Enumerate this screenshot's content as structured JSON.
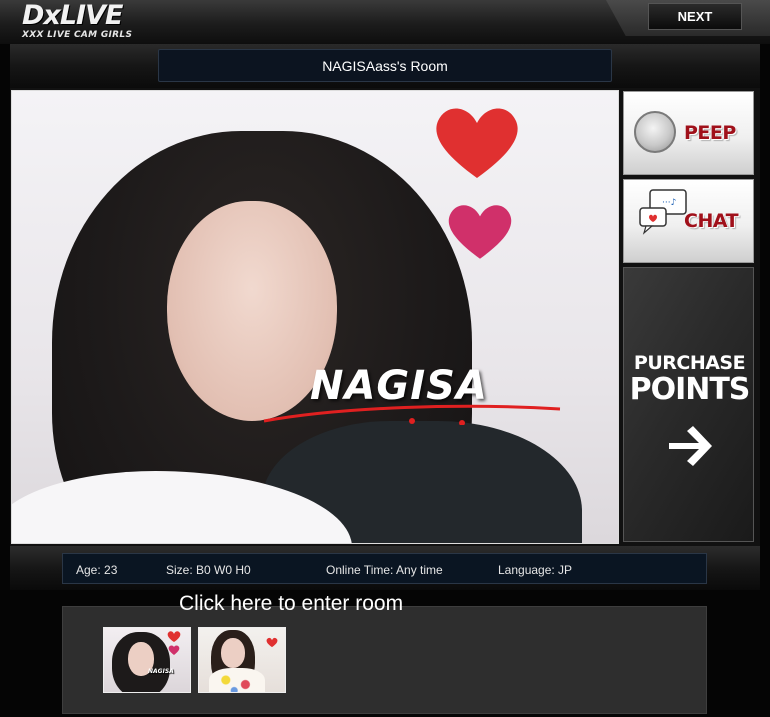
{
  "brand": {
    "logo_main": "DxLIVE",
    "logo_sub": "XXX LIVE CAM GIRLS"
  },
  "header": {
    "next_label": "NEXT"
  },
  "room": {
    "title": "NAGISAass's Room",
    "overlay_name": "NAGISA"
  },
  "side": {
    "peep_label": "PEEP",
    "chat_label": "CHAT",
    "purchase_line1": "PURCHASE",
    "purchase_line2": "POINTS",
    "arrow_glyph": "→"
  },
  "info": {
    "age": "Age: 23",
    "size": "Size: B0 W0 H0",
    "online": "Online Time: Any time",
    "language": "Language: JP"
  },
  "enter": {
    "label": "Click here to enter room",
    "thumb1_text": "NAGISA"
  },
  "colors": {
    "accent_red": "#a0101a",
    "heart_red": "#e03030",
    "heart_pink": "#d0306a",
    "title_bar": "#0c1420"
  },
  "icons": [
    "peep-icon",
    "chat-icon",
    "arrow-right-icon",
    "heart-icon"
  ]
}
